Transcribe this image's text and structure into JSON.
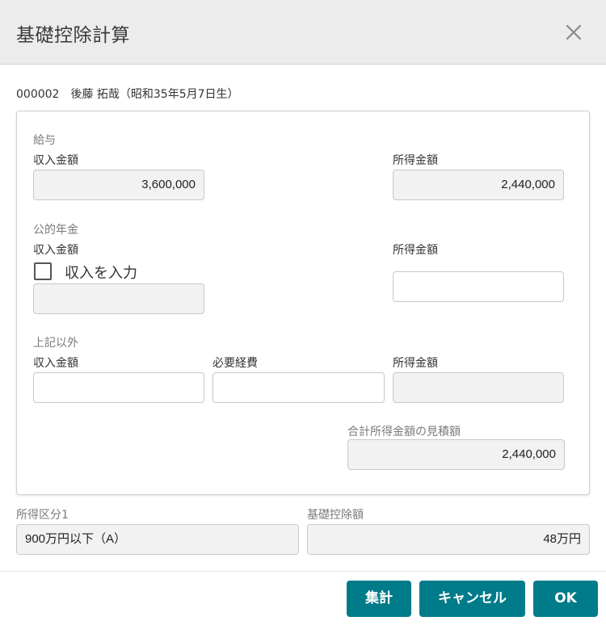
{
  "dialog": {
    "title": "基礎控除計算",
    "close_icon": "close-icon"
  },
  "person": {
    "code": "000002",
    "name": "後藤 拓哉（昭和35年5月7日生）"
  },
  "salary": {
    "section": "給与",
    "income_label": "収入金額",
    "income_value": "3,600,000",
    "earned_label": "所得金額",
    "earned_value": "2,440,000"
  },
  "pension": {
    "section": "公的年金",
    "income_label": "収入金額",
    "checkbox_label": "収入を入力",
    "checkbox_checked": false,
    "income_value": "",
    "earned_label": "所得金額",
    "earned_value": ""
  },
  "other": {
    "section": "上記以外",
    "income_label": "収入金額",
    "income_value": "",
    "expense_label": "必要経費",
    "expense_value": "",
    "earned_label": "所得金額",
    "earned_value": ""
  },
  "total": {
    "label": "合計所得金額の見積額",
    "value": "2,440,000"
  },
  "summary": {
    "category_label": "所得区分1",
    "category_value": "900万円以下（A）",
    "deduction_label": "基礎控除額",
    "deduction_value": "48万円"
  },
  "buttons": {
    "calculate": "集計",
    "cancel": "キャンセル",
    "ok": "OK"
  },
  "colors": {
    "accent": "#007b8a",
    "readonly_bg": "#f3f2f3",
    "header_bg": "#ececec"
  }
}
